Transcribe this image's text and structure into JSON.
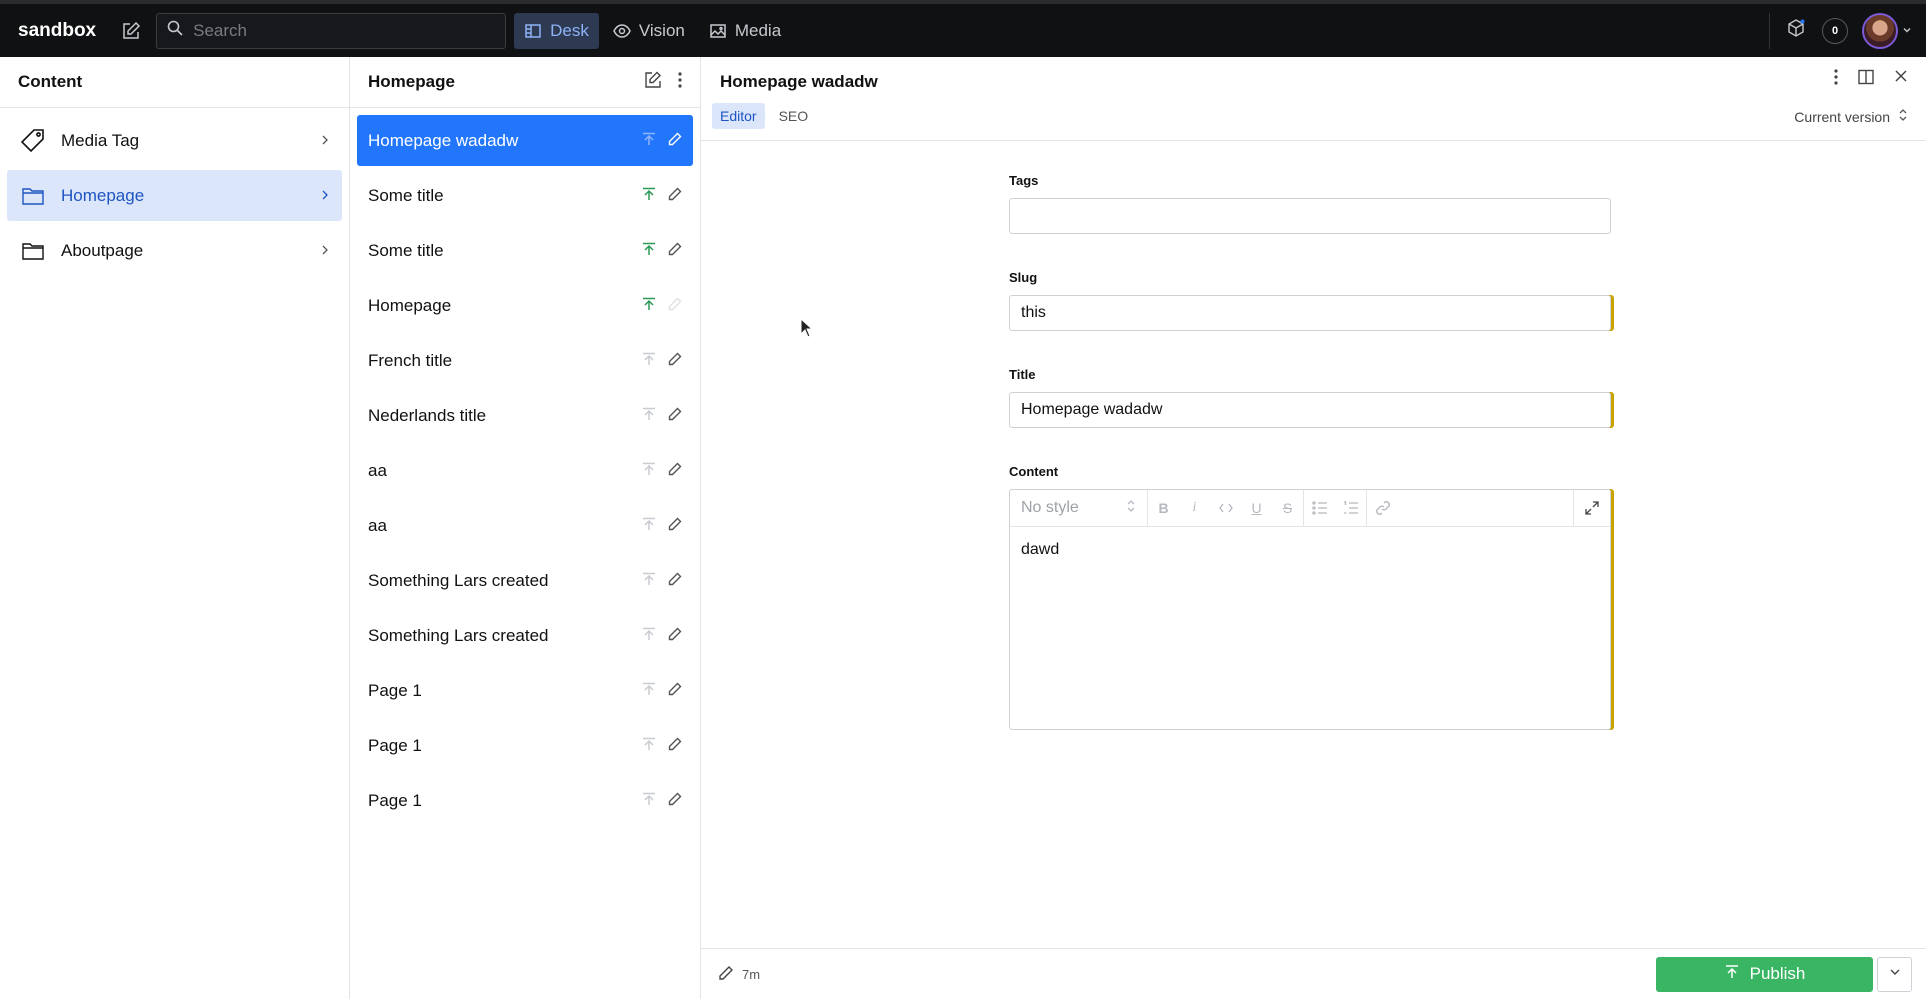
{
  "topbar": {
    "brand": "sandbox",
    "search_placeholder": "Search",
    "nav": [
      {
        "label": "Desk",
        "icon": "desk-icon",
        "active": true
      },
      {
        "label": "Vision",
        "icon": "eye-icon",
        "active": false
      },
      {
        "label": "Media",
        "icon": "image-icon",
        "active": false
      }
    ],
    "notification_count": "0"
  },
  "content_pane": {
    "title": "Content",
    "items": [
      {
        "label": "Media Tag",
        "icon": "tag-icon"
      },
      {
        "label": "Homepage",
        "icon": "folder-icon",
        "selected": true
      },
      {
        "label": "Aboutpage",
        "icon": "folder-icon"
      }
    ]
  },
  "list_pane": {
    "title": "Homepage",
    "items": [
      {
        "label": "Homepage wadadw",
        "selected": true
      },
      {
        "label": "Some title",
        "published": true
      },
      {
        "label": "Some title",
        "published": true
      },
      {
        "label": "Homepage",
        "published": true
      },
      {
        "label": "French title"
      },
      {
        "label": "Nederlands title"
      },
      {
        "label": "aa"
      },
      {
        "label": "aa"
      },
      {
        "label": "Something Lars created"
      },
      {
        "label": "Something Lars created"
      },
      {
        "label": "Page 1"
      },
      {
        "label": "Page 1"
      },
      {
        "label": "Page 1"
      }
    ]
  },
  "document": {
    "title": "Homepage wadadw",
    "tabs": {
      "editor": "Editor",
      "seo": "SEO"
    },
    "version": "Current version",
    "fields": {
      "tags_label": "Tags",
      "tags_value": "",
      "slug_label": "Slug",
      "slug_value": "this",
      "title_label": "Title",
      "title_value": "Homepage wadadw",
      "content_label": "Content",
      "style_placeholder": "No style",
      "content_value": "dawd"
    },
    "footer": {
      "edited_ago": "7m",
      "publish_label": "Publish"
    }
  },
  "colors": {
    "accent": "#2276fc",
    "publish": "#3ab564",
    "changed_marker": "#c9a400",
    "topbar": "#101112"
  }
}
